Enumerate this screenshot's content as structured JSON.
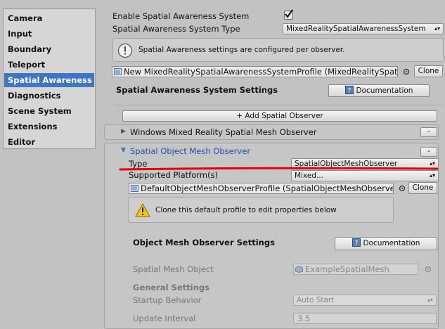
{
  "sidebar": {
    "items": [
      {
        "label": "Camera"
      },
      {
        "label": "Input"
      },
      {
        "label": "Boundary"
      },
      {
        "label": "Teleport"
      },
      {
        "label": "Spatial Awareness"
      },
      {
        "label": "Diagnostics"
      },
      {
        "label": "Scene System"
      },
      {
        "label": "Extensions"
      },
      {
        "label": "Editor"
      }
    ],
    "selected_index": 4
  },
  "system": {
    "enable_label": "Enable Spatial Awareness System",
    "enabled": true,
    "type_label": "Spatial Awareness System Type",
    "type_value": "MixedRealitySpatialAwarenessSystem",
    "info_text": "Spatial Awareness settings are configured per observer.",
    "profile_value": "New MixedRealitySpatialAwarenessSystemProfile (MixedRealitySpati",
    "clone_label": "Clone",
    "settings_title": "Spatial Awareness System Settings",
    "documentation_label": "Documentation",
    "add_observer_label": "+ Add Spatial Observer"
  },
  "observers": [
    {
      "name": "Windows Mixed Reality Spatial Mesh Observer",
      "expanded": false,
      "remove_label": "-"
    },
    {
      "name": "Spatial Object Mesh Observer",
      "expanded": true,
      "remove_label": "-",
      "type_label": "Type",
      "type_value": "SpatialObjectMeshObserver",
      "platforms_label": "Supported Platform(s)",
      "platforms_value": "Mixed...",
      "profile_value": "DefaultObjectMeshObserverProfile (SpatialObjectMeshObserver",
      "clone_label": "Clone",
      "warning_text": "Clone this default profile to edit properties below",
      "settings_title": "Object Mesh Observer Settings",
      "documentation_label": "Documentation",
      "mesh_object_label": "Spatial Mesh Object",
      "mesh_object_value": "ExampleSpatialMesh",
      "general_settings_label": "General Settings",
      "startup_label": "Startup Behavior",
      "startup_value": "Auto Start",
      "interval_label": "Update Interval",
      "interval_value": "3.5"
    }
  ],
  "colors": {
    "selection": "#3c76c4",
    "annotation": "#e00000"
  }
}
